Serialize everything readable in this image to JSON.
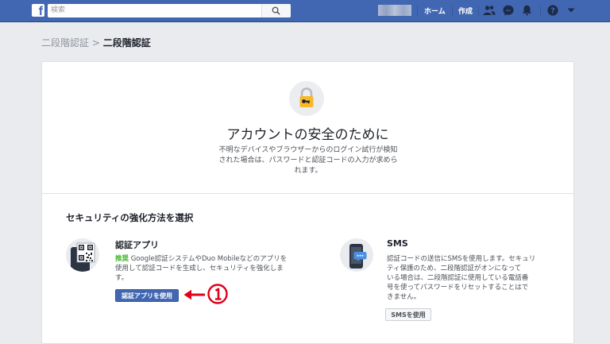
{
  "topbar": {
    "logo": "f",
    "search_placeholder": "検索",
    "nav": {
      "home": "ホーム",
      "create": "作成"
    },
    "icons": [
      "search-icon",
      "friends-icon",
      "messenger-icon",
      "notifications-icon",
      "help-icon",
      "chevron-down-icon"
    ]
  },
  "breadcrumb": {
    "parent": "二段階認証",
    "separator": ">",
    "current": "二段階認証"
  },
  "hero": {
    "icon": "lock-key-icon",
    "title": "アカウントの安全のために",
    "description_lines": [
      "不明なデバイスやブラウザーからのログイン試行が検知",
      "された場合は、パスワードと認証コードの入力が求めら",
      "れます。"
    ]
  },
  "methods": {
    "title": "セキュリティの強化方法を選択",
    "auth_app": {
      "icon": "qr-phone-icon",
      "title": "認証アプリ",
      "recommended": "推奨",
      "description_lines": [
        "Google認証システムやDuo Mobileなどのアプリを",
        "使用して認証コードを生成し、セキュリティを強化しま",
        "す。"
      ],
      "button": "認証アプリを使用"
    },
    "sms": {
      "icon": "phone-sms-icon",
      "title": "SMS",
      "description_lines": [
        "認証コードの送信にSMSを使用します。セキュリ",
        "ティ保護のため、二段階認証がオンになって",
        "いる場合は、二段階認証に使用している電話番",
        "号を使ってパスワードをリセットすることはで",
        "きません。"
      ],
      "button": "SMSを使用"
    }
  },
  "annotation": {
    "arrow": "←",
    "number": "①"
  },
  "colors": {
    "brand": "#4267b2",
    "recommended": "#42b72a",
    "annotation": "#e0001b"
  }
}
